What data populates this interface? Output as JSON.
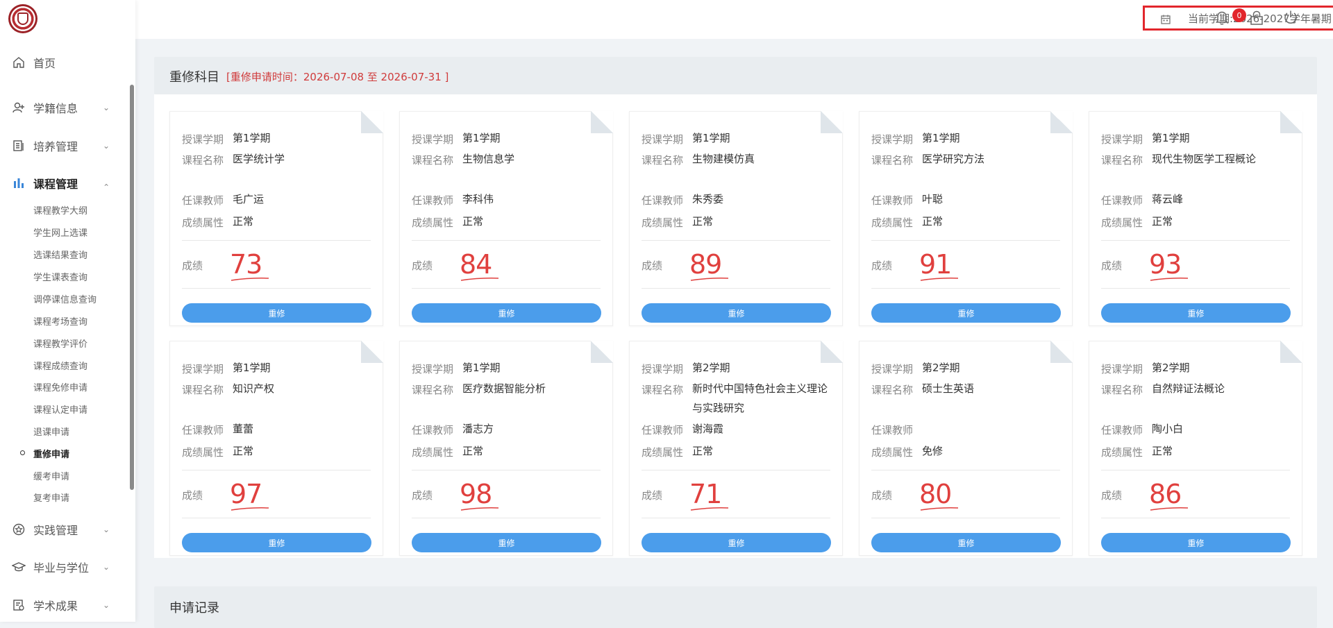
{
  "sidebar": {
    "menu": [
      {
        "label": "首页",
        "icon": "home-icon"
      },
      {
        "label": "学籍信息",
        "icon": "user-plus-icon"
      },
      {
        "label": "培养管理",
        "icon": "document-list-icon"
      },
      {
        "label": "课程管理",
        "icon": "bar-chart-icon"
      },
      {
        "label": "实践管理",
        "icon": "star-circle-icon"
      },
      {
        "label": "毕业与学位",
        "icon": "graduation-cap-icon"
      },
      {
        "label": "学术成果",
        "icon": "certificate-icon"
      }
    ],
    "submenu": [
      "课程教学大纲",
      "学生网上选课",
      "选课结果查询",
      "学生课表查询",
      "调停课信息查询",
      "课程考场查询",
      "课程教学评价",
      "课程成绩查询",
      "课程免修申请",
      "课程认定申请",
      "退课申请",
      "重修申请",
      "缓考申请",
      "复考申请"
    ]
  },
  "header": {
    "term": "当前学期:2026-2027学年暑期",
    "notification_count": "0"
  },
  "retake_section": {
    "title": "重修科目",
    "period": "[重修申请时间：2026-07-08   至 2026-07-31   ]"
  },
  "labels": {
    "semester": "授课学期",
    "course_name": "课程名称",
    "teacher": "任课教师",
    "grade_attr": "成绩属性",
    "score": "成绩",
    "button": "重修"
  },
  "cards": [
    {
      "semester": "第1学期",
      "course": "医学统计学",
      "teacher": "毛广运",
      "attr": "正常",
      "score": "73"
    },
    {
      "semester": "第1学期",
      "course": "生物信息学",
      "teacher": "李科伟",
      "attr": "正常",
      "score": "84"
    },
    {
      "semester": "第1学期",
      "course": "生物建模仿真",
      "teacher": "朱秀委",
      "attr": "正常",
      "score": "89"
    },
    {
      "semester": "第1学期",
      "course": "医学研究方法",
      "teacher": "叶聪",
      "attr": "正常",
      "score": "91"
    },
    {
      "semester": "第1学期",
      "course": "现代生物医学工程概论",
      "teacher": "蒋云峰",
      "attr": "正常",
      "score": "93"
    },
    {
      "semester": "第1学期",
      "course": "知识产权",
      "teacher": "董蕾",
      "attr": "正常",
      "score": "97"
    },
    {
      "semester": "第1学期",
      "course": "医疗数据智能分析",
      "teacher": "潘志方",
      "attr": "正常",
      "score": "98"
    },
    {
      "semester": "第2学期",
      "course": "新时代中国特色社会主义理论与实践研究",
      "teacher": "谢海霞",
      "attr": "正常",
      "score": "71"
    },
    {
      "semester": "第2学期",
      "course": "硕士生英语",
      "teacher": "",
      "attr": "免修",
      "score": "80"
    },
    {
      "semester": "第2学期",
      "course": "自然辩证法概论",
      "teacher": "陶小白",
      "attr": "正常",
      "score": "86"
    }
  ],
  "records_section": {
    "title": "申请记录"
  },
  "colors": {
    "accent_blue": "#4b9deb",
    "score_red": "#e0403e",
    "alert_red": "#e2262c"
  }
}
